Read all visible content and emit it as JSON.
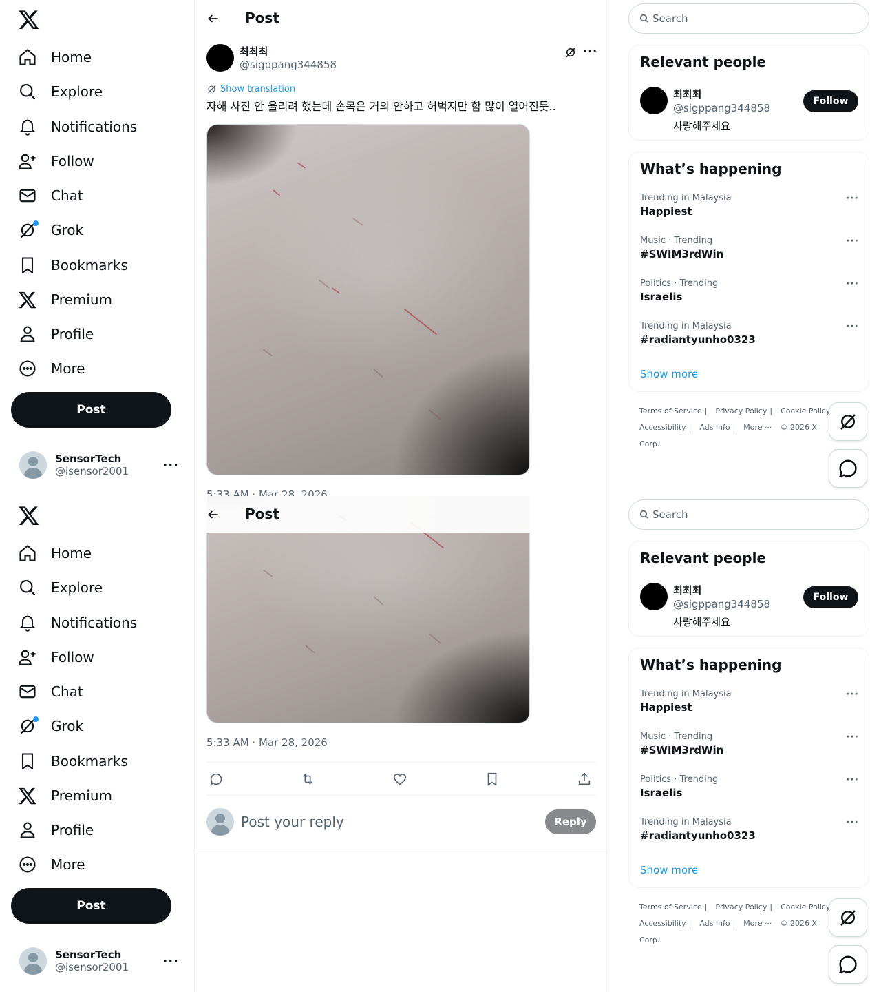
{
  "nav": {
    "items": [
      {
        "label": "Home",
        "icon": "home-icon"
      },
      {
        "label": "Explore",
        "icon": "search-icon"
      },
      {
        "label": "Notifications",
        "icon": "bell-icon"
      },
      {
        "label": "Follow",
        "icon": "person-add-icon"
      },
      {
        "label": "Chat",
        "icon": "envelope-icon"
      },
      {
        "label": "Grok",
        "icon": "grok-icon"
      },
      {
        "label": "Bookmarks",
        "icon": "bookmark-icon"
      },
      {
        "label": "Premium",
        "icon": "x-logo-icon"
      },
      {
        "label": "Profile",
        "icon": "person-icon"
      },
      {
        "label": "More",
        "icon": "more-circle-icon"
      }
    ],
    "post_button": "Post"
  },
  "account": {
    "name": "SensorTech",
    "handle": "@isensor2001"
  },
  "header": {
    "title": "Post"
  },
  "post": {
    "author_name": "최최최",
    "author_handle": "@sigppang344858",
    "show_translation": "Show translation",
    "text": "자해 사진 안 올리려 했는데 손목은 거의 안하고 허벅지만 함 많이 열어진듯..",
    "timestamp": "5:33 AM · Mar 28, 2026"
  },
  "reply": {
    "placeholder": "Post your reply",
    "button": "Reply"
  },
  "search": {
    "placeholder": "Search"
  },
  "relevant_people": {
    "title": "Relevant people",
    "name": "최최최",
    "handle": "@sigppang344858",
    "bio": "사랑해주세요",
    "follow": "Follow"
  },
  "happening": {
    "title": "What’s happening",
    "trends": [
      {
        "context": "Trending in Malaysia",
        "name": "Happiest"
      },
      {
        "context": "Music · Trending",
        "name": "#SWIM3rdWin"
      },
      {
        "context": "Politics · Trending",
        "name": "Israelis"
      },
      {
        "context": "Trending in Malaysia",
        "name": "#radiantyunho0323"
      }
    ],
    "show_more": "Show more"
  },
  "footer": {
    "links": [
      "Terms of Service",
      "Privacy Policy",
      "Cookie Policy",
      "Accessibility",
      "Ads info",
      "More ···",
      "© 2026 X Corp."
    ]
  },
  "colors": {
    "accent": "#1d9bf0",
    "text": "#0f1419",
    "muted": "#536471",
    "border": "#eff3f4"
  }
}
